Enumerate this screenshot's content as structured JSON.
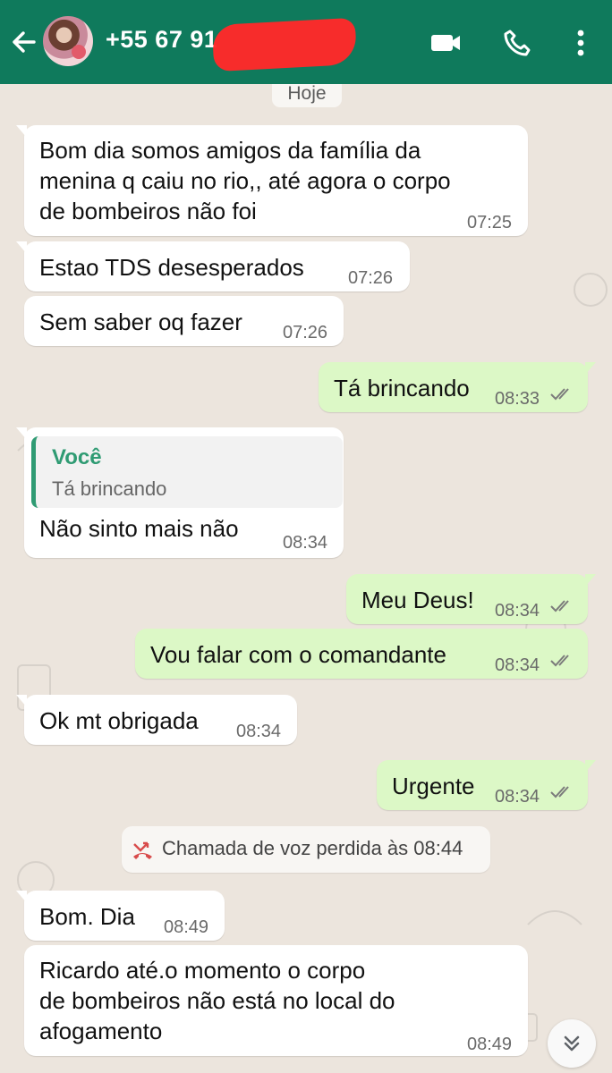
{
  "header": {
    "contact": "+55 67 91",
    "colors": {
      "bar": "#0f7a5c",
      "redaction": "#ff2929"
    }
  },
  "icons": {
    "back": "arrow-left-icon",
    "video": "video-call-icon",
    "call": "phone-icon",
    "menu": "more-vert-icon",
    "missed": "missed-call-icon",
    "scroll": "chevron-double-down-icon"
  },
  "chat": {
    "date": "Hoje",
    "messages": [
      {
        "dir": "in",
        "lines": [
          "Bom dia somos amigos da família da",
          "menina q caiu no rio,, até agora o corpo",
          "de bombeiros não foi"
        ],
        "time": "07:25"
      },
      {
        "dir": "in",
        "text": "Estao TDS desesperados",
        "time": "07:26"
      },
      {
        "dir": "in",
        "text": "Sem saber oq fazer",
        "time": "07:26"
      },
      {
        "dir": "out",
        "text": "Tá brincando",
        "time": "08:33"
      },
      {
        "dir": "in",
        "quote_author": "Você",
        "quote_text": "Tá brincando",
        "text": "Não sinto mais não",
        "time": "08:34"
      },
      {
        "dir": "out",
        "text": "Meu Deus!",
        "time": "08:34"
      },
      {
        "dir": "out",
        "text": "Vou falar com o comandante",
        "time": "08:34"
      },
      {
        "dir": "in",
        "text": "Ok mt obrigada",
        "time": "08:34"
      },
      {
        "dir": "out",
        "text": "Urgente",
        "time": "08:34"
      },
      {
        "dir": "in",
        "text": "Bom. Dia",
        "time": "08:49"
      },
      {
        "dir": "in",
        "lines": [
          "Ricardo até.o momento o corpo",
          "de bombeiros não está no local do",
          "afogamento"
        ],
        "time": "08:49"
      }
    ],
    "system": "Chamada de voz perdida às 08:44",
    "colors": {
      "incoming": "#ffffff",
      "outgoing": "#dcf8c6",
      "quote_accent": "#2f9b73",
      "missed_call": "#d84b4b"
    }
  }
}
